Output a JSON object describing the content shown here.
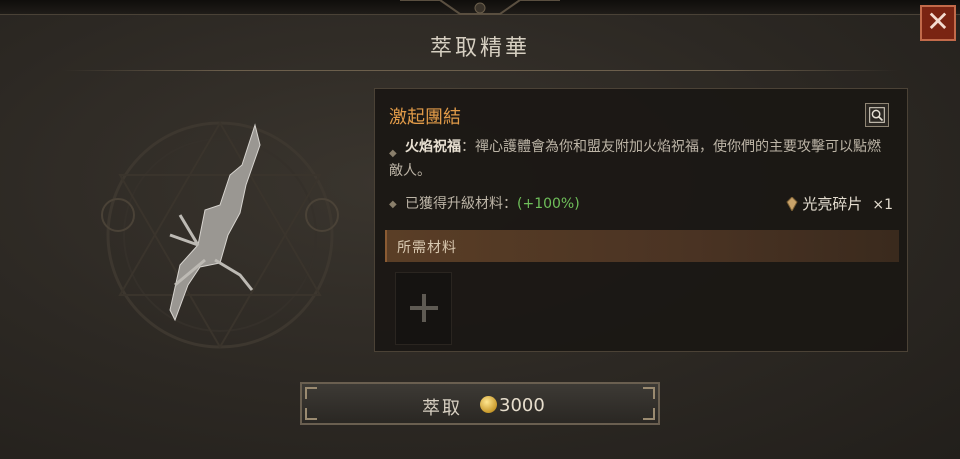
{
  "window": {
    "title": "萃取精華",
    "close_label": "✕"
  },
  "aspect": {
    "name": "激起團結",
    "effect_name": "火焰祝福",
    "effect_separator": "：",
    "effect_text": "禪心護體會為你和盟友附加火焰祝福，使你們的主要攻擊可以點燃敵人。",
    "upgrade_label": "已獲得升級材料：",
    "upgrade_value": "(+100%)",
    "reward_name": "光亮碎片",
    "reward_qty": "×1"
  },
  "materials": {
    "header": "所需材料"
  },
  "extract": {
    "label": "萃取",
    "cost": "3000"
  },
  "colors": {
    "aspect_name": "#e09a48",
    "upgrade_pct": "#6fbf5a",
    "close_bg": "#7a2412"
  },
  "icons": [
    "close-icon",
    "magnify-icon",
    "bullet-icon",
    "shard-icon",
    "cross-icon",
    "gold-coin-icon",
    "weapon-sigil-icon"
  ]
}
